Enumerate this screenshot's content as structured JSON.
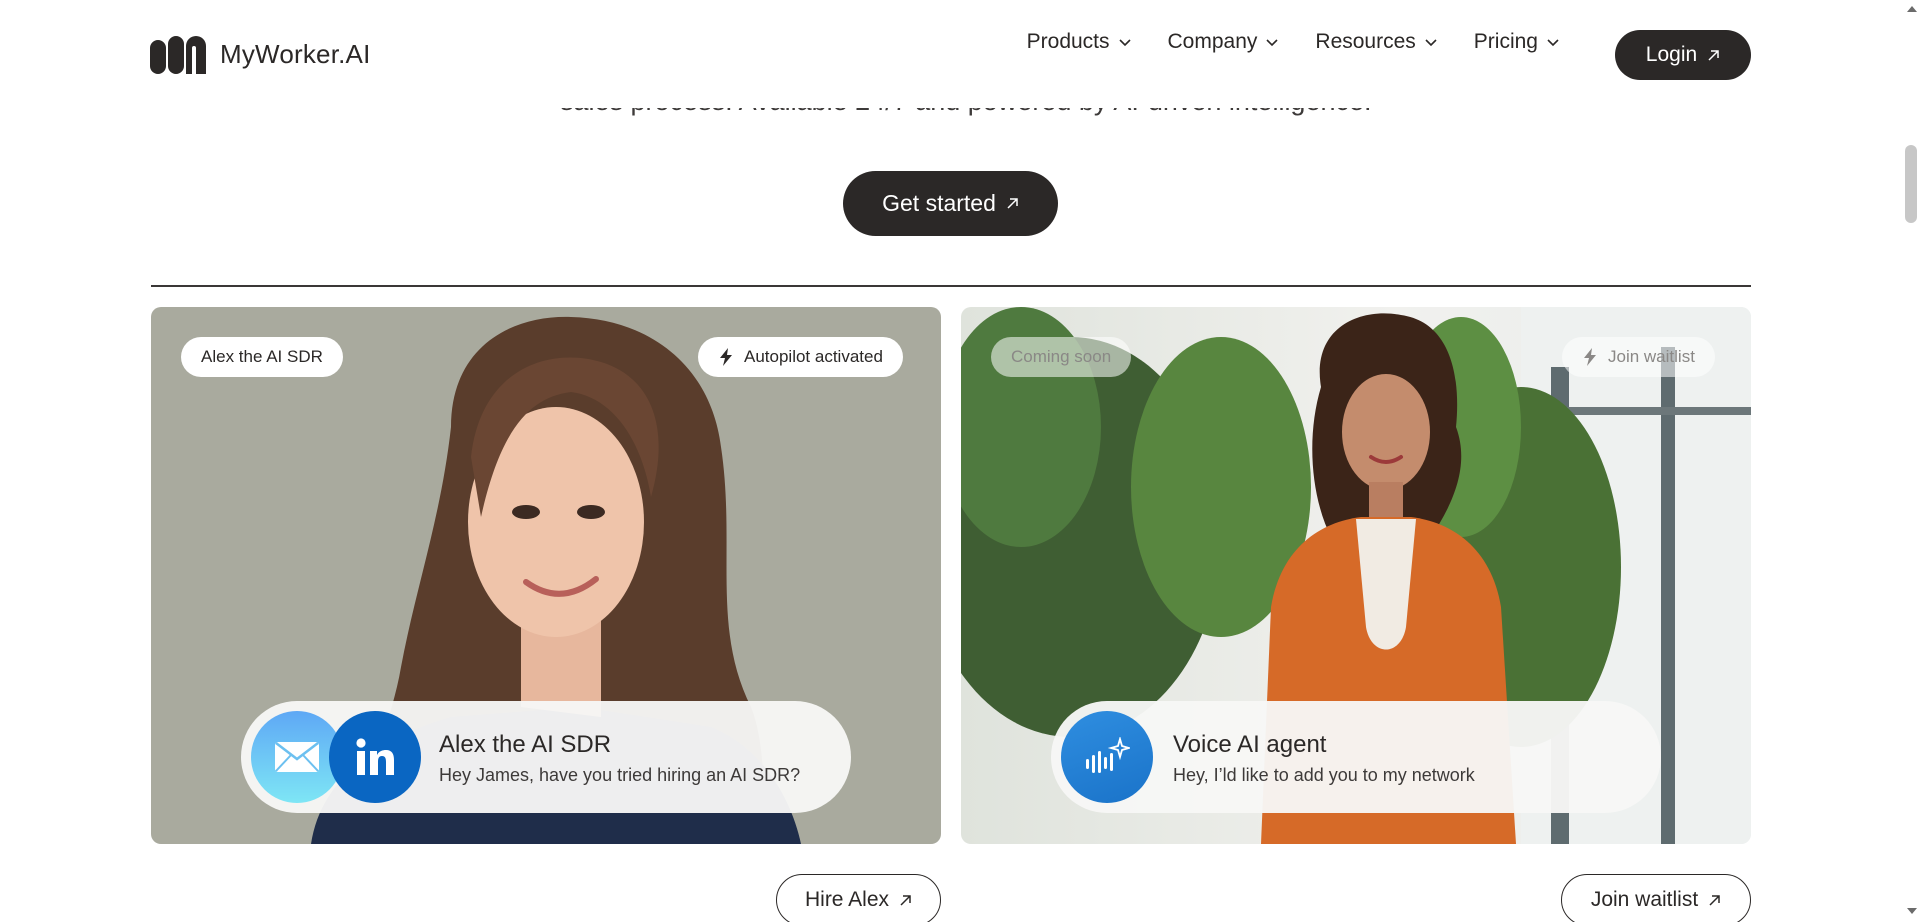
{
  "header": {
    "brand": "MyWorker.AI",
    "nav": [
      {
        "label": "Products"
      },
      {
        "label": "Company"
      },
      {
        "label": "Resources"
      },
      {
        "label": "Pricing"
      }
    ],
    "login_label": "Login"
  },
  "hero": {
    "intro_partial": "sales process. Available 24/7 and powered by AI-driven intelligence.",
    "cta_label": "Get started"
  },
  "cards": [
    {
      "tag": "Alex the AI SDR",
      "status": "Autopilot activated",
      "bubble_title": "Alex the AI SDR",
      "bubble_message": "Hey James, have you tried hiring an AI SDR?",
      "icons": [
        "email-icon",
        "linkedin-icon"
      ],
      "button_label": "Hire Alex"
    },
    {
      "tag": "Coming soon",
      "status": "Join waitlist",
      "bubble_title": "Voice AI agent",
      "bubble_message": "Hey, I’ld like to add you to my network",
      "icons": [
        "voice-ai-icon"
      ],
      "button_label": "Join waitlist"
    }
  ],
  "colors": {
    "primary_dark": "#2b2827",
    "left_card_bg": "#a9aa9e",
    "linkedin_blue": "#0a66c2",
    "email_gradient_top": "#5ea8f5",
    "email_gradient_bottom": "#7ee6f5"
  }
}
